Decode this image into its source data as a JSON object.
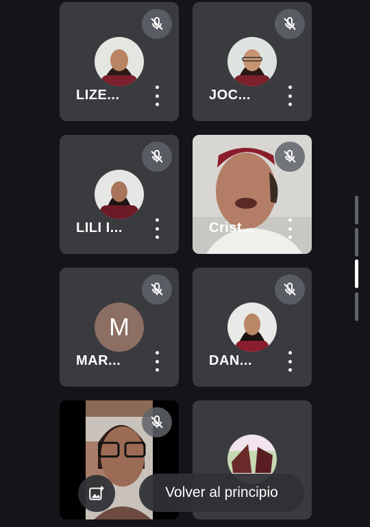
{
  "participants": [
    {
      "name": "LIZE...",
      "muted": true,
      "avatar": "photo"
    },
    {
      "name": "JOC...",
      "muted": true,
      "avatar": "photo"
    },
    {
      "name": "LILI I...",
      "muted": true,
      "avatar": "photo"
    },
    {
      "name": "Crist...",
      "muted": true,
      "avatar": "video"
    },
    {
      "name": "MAR...",
      "muted": true,
      "avatar": "initial",
      "initial": "M"
    },
    {
      "name": "DAN...",
      "muted": true,
      "avatar": "photo"
    },
    {
      "name": "",
      "muted": true,
      "avatar": "video"
    },
    {
      "name": "",
      "muted": false,
      "avatar": "photo"
    }
  ],
  "scroll_to_top_button": {
    "label": "Volver al principio"
  },
  "icons": {
    "muted": "mic-off-icon",
    "more": "more-vert-icon",
    "effects": "add-photo-icon"
  },
  "scroll_indicator": {
    "segments": 4,
    "active_segment": 3
  },
  "colors": {
    "background": "#141519",
    "tile": "#3a3b3f",
    "mute_badge": "#5f6368",
    "uniform": "#7a1f2b",
    "avatar_M": "#8d6e63"
  }
}
